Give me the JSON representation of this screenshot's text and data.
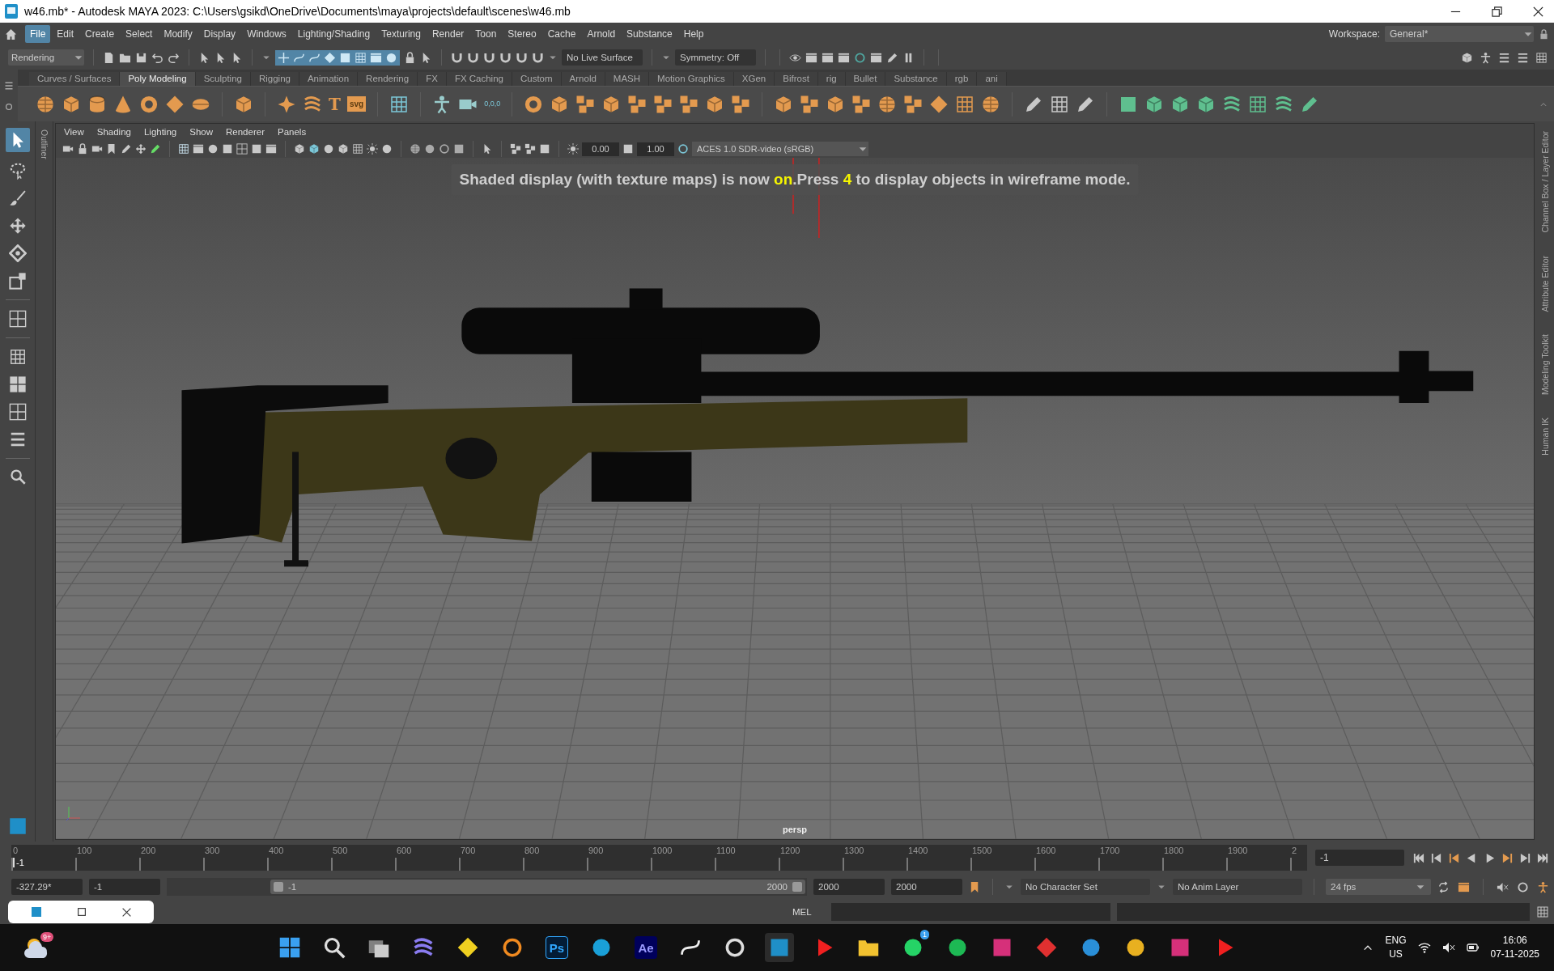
{
  "window": {
    "title": "w46.mb* - Autodesk MAYA 2023: C:\\Users\\gsikd\\OneDrive\\Documents\\maya\\projects\\default\\scenes\\w46.mb"
  },
  "menu_bar": [
    {
      "label": "File",
      "selected": true
    },
    {
      "label": "Edit",
      "selected": false
    },
    {
      "label": "Create",
      "selected": false
    },
    {
      "label": "Select",
      "selected": false
    },
    {
      "label": "Modify",
      "selected": false
    },
    {
      "label": "Display",
      "selected": false
    },
    {
      "label": "Windows",
      "selected": false
    },
    {
      "label": "Lighting/Shading",
      "selected": false
    },
    {
      "label": "Texturing",
      "selected": false
    },
    {
      "label": "Render",
      "selected": false
    },
    {
      "label": "Toon",
      "selected": false
    },
    {
      "label": "Stereo",
      "selected": false
    },
    {
      "label": "Cache",
      "selected": false
    },
    {
      "label": "Arnold",
      "selected": false
    },
    {
      "label": "Substance",
      "selected": false
    },
    {
      "label": "Help",
      "selected": false
    }
  ],
  "status_line": {
    "menu_set": "Rendering",
    "live_surface": "No Live Surface",
    "symmetry": "Symmetry: Off",
    "workspace_label": "Workspace:",
    "workspace": "General*"
  },
  "shelf_tabs": [
    {
      "label": "Curves / Surfaces",
      "selected": false
    },
    {
      "label": "Poly Modeling",
      "selected": true
    },
    {
      "label": "Sculpting",
      "selected": false
    },
    {
      "label": "Rigging",
      "selected": false
    },
    {
      "label": "Animation",
      "selected": false
    },
    {
      "label": "Rendering",
      "selected": false
    },
    {
      "label": "FX",
      "selected": false
    },
    {
      "label": "FX Caching",
      "selected": false
    },
    {
      "label": "Custom",
      "selected": false
    },
    {
      "label": "Arnold",
      "selected": false
    },
    {
      "label": "MASH",
      "selected": false
    },
    {
      "label": "Motion Graphics",
      "selected": false
    },
    {
      "label": "XGen",
      "selected": false
    },
    {
      "label": "Bifrost",
      "selected": false
    },
    {
      "label": "rig",
      "selected": false
    },
    {
      "label": "Bullet",
      "selected": false
    },
    {
      "label": "Substance",
      "selected": false
    },
    {
      "label": "rgb",
      "selected": false
    },
    {
      "label": "ani",
      "selected": false
    }
  ],
  "shelf": {
    "type_tool": "T",
    "svg_tool": "svg",
    "snap_tool": "0,0,0"
  },
  "side_tab_left": "Outliner",
  "side_tabs_right": [
    "Channel Box / Layer Editor",
    "Attribute Editor",
    "Modeling Toolkit",
    "Human IK"
  ],
  "panel_menu": [
    "View",
    "Shading",
    "Lighting",
    "Show",
    "Renderer",
    "Panels"
  ],
  "panel_toolbar": {
    "exposure": "0.00",
    "gamma": "1.00",
    "color_space": "ACES 1.0 SDR-video (sRGB)"
  },
  "viewport": {
    "message": "Shaded display (with texture maps) is now **on**.Press **4** to display objects in wireframe mode.",
    "camera": "persp"
  },
  "time_slider": {
    "ticks": [
      "0",
      "100",
      "200",
      "300",
      "400",
      "500",
      "600",
      "700",
      "800",
      "900",
      "1000",
      "1100",
      "1200",
      "1300",
      "1400",
      "1500",
      "1600",
      "1700",
      "1800",
      "1900",
      "2"
    ],
    "current_frame": "-1",
    "level": 0,
    "frame_field": "-1"
  },
  "range_slider": {
    "start_time": "-327.29*",
    "start": "-1",
    "level": 1,
    "range_start": "-1",
    "range_end": "2000",
    "end": "2000",
    "end_time": "2000",
    "character_set": "No Character Set",
    "anim_layer": "No Anim Layer",
    "fps": "24 fps"
  },
  "command_line": {
    "language": "MEL"
  },
  "taskbar": {
    "weather_badge": "9+",
    "photoshop": "Ps",
    "after_effects": "Ae",
    "whatsapp_badge": "1",
    "language": "ENG",
    "region": "US",
    "time": "16:06",
    "date": "07-11-2025"
  }
}
